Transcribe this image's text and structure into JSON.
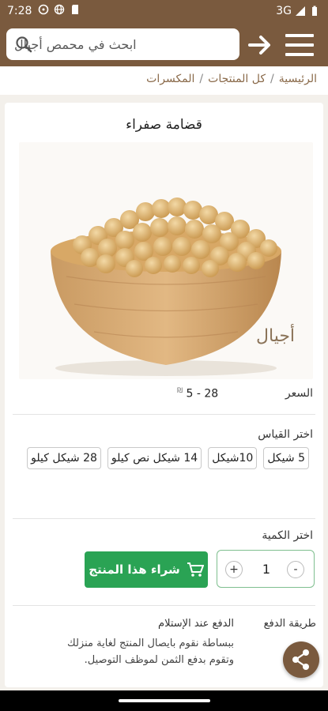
{
  "status_bar": {
    "time": "7:28",
    "network": "3G"
  },
  "header": {
    "search_placeholder": "ابحث في محمص أجيال",
    "icons": [
      "search-icon",
      "arrow-right-icon",
      "menu-icon"
    ]
  },
  "breadcrumb": {
    "items": [
      "الرئيسية",
      "كل المنتجات",
      "المكسرات"
    ],
    "separator": "/"
  },
  "product": {
    "title": "قضامة صفراء",
    "image_watermark": "أجيال",
    "price_label": "السعر",
    "price_value": "5 - 28",
    "currency": "₪",
    "size_label": "اختر القياس",
    "sizes": [
      "5 شيكل",
      "10شيكل",
      "14 شيكل نص كيلو",
      "28 شيكل كيلو"
    ],
    "quantity_label": "اختر الكمية",
    "quantity": "1",
    "minus": "-",
    "plus": "+",
    "buy_label": "شراء هذا المنتج",
    "payment_label": "طريقة الدفع",
    "payment_title": "الدفع عند الإستلام",
    "payment_desc": "ببساطة نقوم بايصال المنتج لغاية منزلك وتقوم بدفع الثمن لموظف التوصيل."
  },
  "colors": {
    "brand": "#7a5a3e",
    "buy": "#2aa354"
  }
}
